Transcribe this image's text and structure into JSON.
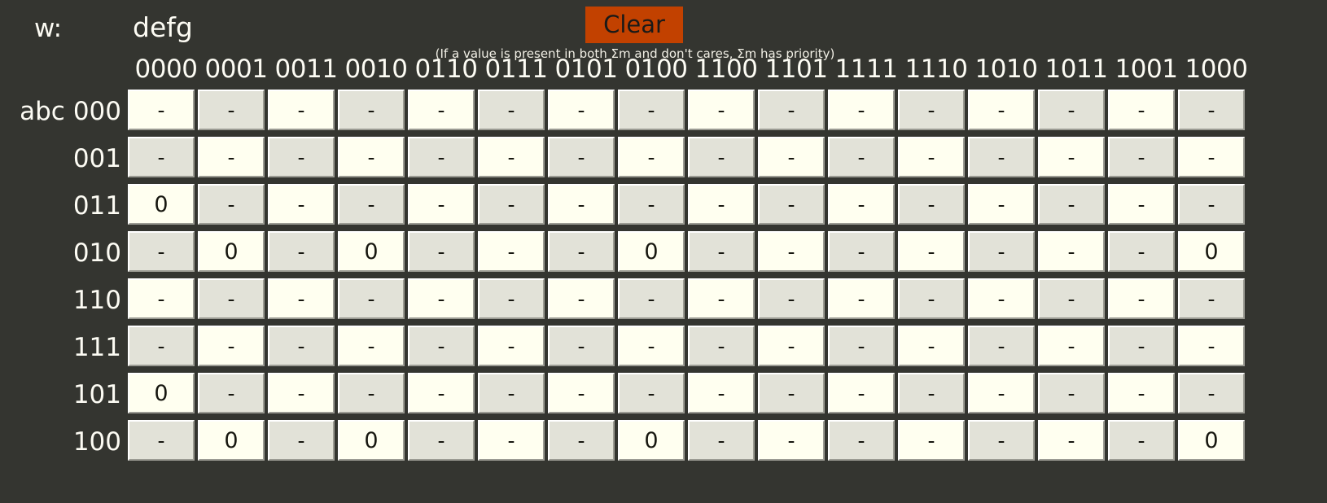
{
  "header": {
    "w_label": "w:",
    "col_variables": "defg",
    "row_variables": "abc",
    "clear_label": "Clear",
    "priority_note": "(If a value is present in both Σm and don't cares, Σm has priority)"
  },
  "colors": {
    "background": "#343530",
    "clear_button": "#c24100",
    "clear_button_text": "#1a1a18",
    "text": "#fdfcf4",
    "cell_light": "#fffff0",
    "cell_dark": "#e2e2d8",
    "cell_text": "#16160f",
    "cell_highlight_border": "#ffffff",
    "cell_shadow_border": "#9b9b93"
  },
  "kmap": {
    "column_labels": [
      "0000",
      "0001",
      "0011",
      "0010",
      "0110",
      "0111",
      "0101",
      "0100",
      "1100",
      "1101",
      "1111",
      "1110",
      "1010",
      "1011",
      "1001",
      "1000"
    ],
    "row_labels": [
      "000",
      "001",
      "011",
      "010",
      "110",
      "111",
      "101",
      "100"
    ],
    "dont_care_symbol": "-",
    "rows": [
      {
        "label": "000",
        "values": [
          "-",
          "-",
          "-",
          "-",
          "-",
          "-",
          "-",
          "-",
          "-",
          "-",
          "-",
          "-",
          "-",
          "-",
          "-",
          "-"
        ]
      },
      {
        "label": "001",
        "values": [
          "-",
          "-",
          "-",
          "-",
          "-",
          "-",
          "-",
          "-",
          "-",
          "-",
          "-",
          "-",
          "-",
          "-",
          "-",
          "-"
        ]
      },
      {
        "label": "011",
        "values": [
          "0",
          "-",
          "-",
          "-",
          "-",
          "-",
          "-",
          "-",
          "-",
          "-",
          "-",
          "-",
          "-",
          "-",
          "-",
          "-"
        ]
      },
      {
        "label": "010",
        "values": [
          "-",
          "0",
          "-",
          "0",
          "-",
          "-",
          "-",
          "0",
          "-",
          "-",
          "-",
          "-",
          "-",
          "-",
          "-",
          "0"
        ]
      },
      {
        "label": "110",
        "values": [
          "-",
          "-",
          "-",
          "-",
          "-",
          "-",
          "-",
          "-",
          "-",
          "-",
          "-",
          "-",
          "-",
          "-",
          "-",
          "-"
        ]
      },
      {
        "label": "111",
        "values": [
          "-",
          "-",
          "-",
          "-",
          "-",
          "-",
          "-",
          "-",
          "-",
          "-",
          "-",
          "-",
          "-",
          "-",
          "-",
          "-"
        ]
      },
      {
        "label": "101",
        "values": [
          "0",
          "-",
          "-",
          "-",
          "-",
          "-",
          "-",
          "-",
          "-",
          "-",
          "-",
          "-",
          "-",
          "-",
          "-",
          "-"
        ]
      },
      {
        "label": "100",
        "values": [
          "-",
          "0",
          "-",
          "0",
          "-",
          "-",
          "-",
          "0",
          "-",
          "-",
          "-",
          "-",
          "-",
          "-",
          "-",
          "0"
        ]
      }
    ]
  }
}
